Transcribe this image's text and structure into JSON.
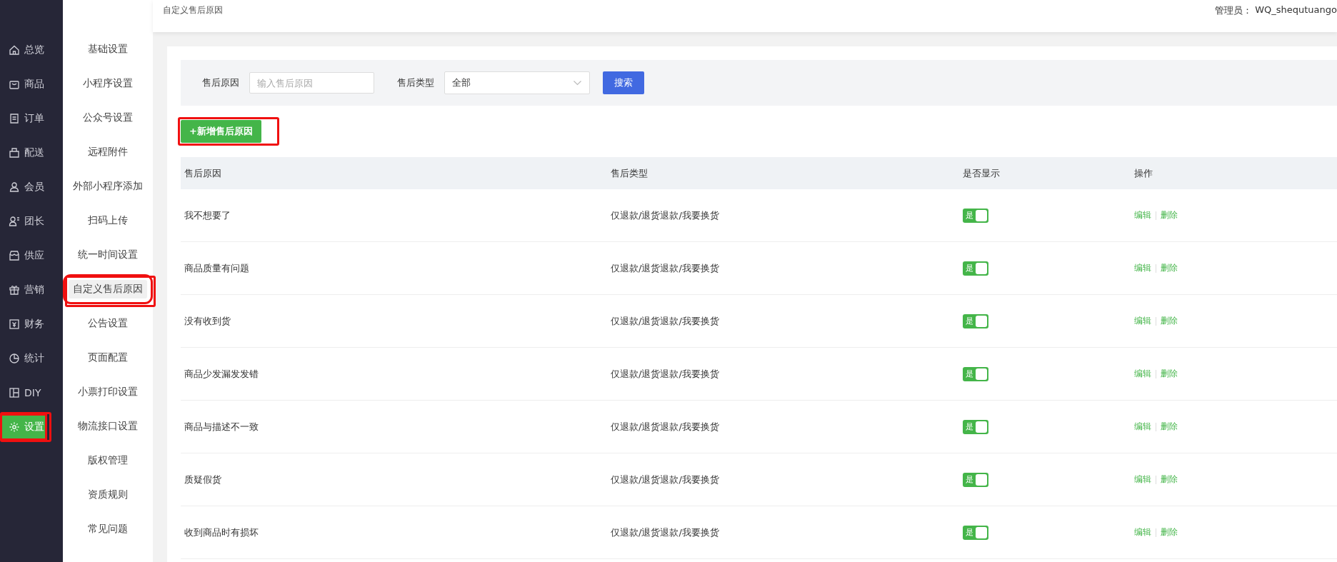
{
  "sidebar": {
    "items": [
      {
        "label": "总览",
        "selected": false,
        "highlighted": false
      },
      {
        "label": "商品",
        "selected": false,
        "highlighted": false
      },
      {
        "label": "订单",
        "selected": false,
        "highlighted": false
      },
      {
        "label": "配送",
        "selected": false,
        "highlighted": false
      },
      {
        "label": "会员",
        "selected": false,
        "highlighted": false
      },
      {
        "label": "团长",
        "selected": false,
        "highlighted": false
      },
      {
        "label": "供应",
        "selected": false,
        "highlighted": false
      },
      {
        "label": "营销",
        "selected": false,
        "highlighted": false
      },
      {
        "label": "财务",
        "selected": false,
        "highlighted": false
      },
      {
        "label": "统计",
        "selected": false,
        "highlighted": false
      },
      {
        "label": "DIY",
        "selected": false,
        "highlighted": false
      },
      {
        "label": "设置",
        "selected": true,
        "highlighted": true
      }
    ]
  },
  "submenu": {
    "items": [
      {
        "label": "基础设置",
        "selected": false,
        "highlighted": false
      },
      {
        "label": "小程序设置",
        "selected": false,
        "highlighted": false
      },
      {
        "label": "公众号设置",
        "selected": false,
        "highlighted": false
      },
      {
        "label": "远程附件",
        "selected": false,
        "highlighted": false
      },
      {
        "label": "外部小程序添加",
        "selected": false,
        "highlighted": false
      },
      {
        "label": "扫码上传",
        "selected": false,
        "highlighted": false
      },
      {
        "label": "统一时间设置",
        "selected": false,
        "highlighted": false
      },
      {
        "label": "自定义售后原因",
        "selected": true,
        "highlighted": true
      },
      {
        "label": "公告设置",
        "selected": false,
        "highlighted": false
      },
      {
        "label": "页面配置",
        "selected": false,
        "highlighted": false
      },
      {
        "label": "小票打印设置",
        "selected": false,
        "highlighted": false
      },
      {
        "label": "物流接口设置",
        "selected": false,
        "highlighted": false
      },
      {
        "label": "版权管理",
        "selected": false,
        "highlighted": false
      },
      {
        "label": "资质规则",
        "selected": false,
        "highlighted": false
      },
      {
        "label": "常见问题",
        "selected": false,
        "highlighted": false
      }
    ]
  },
  "header": {
    "breadcrumb": "自定义售后原因",
    "admin_label": "管理员：",
    "admin_name": "WQ_shequtuango"
  },
  "filter": {
    "reason_label": "售后原因",
    "reason_placeholder": "输入售后原因",
    "type_label": "售后类型",
    "type_value": "全部",
    "search_button": "搜索"
  },
  "add_button": {
    "label": "+新增售后原因",
    "highlighted": true
  },
  "table": {
    "columns": [
      "售后原因",
      "售后类型",
      "是否显示",
      "操作"
    ],
    "rows": [
      {
        "reason": "我不想要了",
        "type": "仅退款/退货退款/我要换货",
        "shown": true,
        "toggle_label": "是",
        "actions": [
          "编辑",
          "删除"
        ]
      },
      {
        "reason": "商品质量有问题",
        "type": "仅退款/退货退款/我要换货",
        "shown": true,
        "toggle_label": "是",
        "actions": [
          "编辑",
          "删除"
        ]
      },
      {
        "reason": "没有收到货",
        "type": "仅退款/退货退款/我要换货",
        "shown": true,
        "toggle_label": "是",
        "actions": [
          "编辑",
          "删除"
        ]
      },
      {
        "reason": "商品少发漏发发错",
        "type": "仅退款/退货退款/我要换货",
        "shown": true,
        "toggle_label": "是",
        "actions": [
          "编辑",
          "删除"
        ]
      },
      {
        "reason": "商品与描述不一致",
        "type": "仅退款/退货退款/我要换货",
        "shown": true,
        "toggle_label": "是",
        "actions": [
          "编辑",
          "删除"
        ]
      },
      {
        "reason": "质疑假货",
        "type": "仅退款/退货退款/我要换货",
        "shown": true,
        "toggle_label": "是",
        "actions": [
          "编辑",
          "删除"
        ]
      },
      {
        "reason": "收到商品时有损坏",
        "type": "仅退款/退货退款/我要换货",
        "shown": true,
        "toggle_label": "是",
        "actions": [
          "编辑",
          "删除"
        ]
      }
    ]
  }
}
